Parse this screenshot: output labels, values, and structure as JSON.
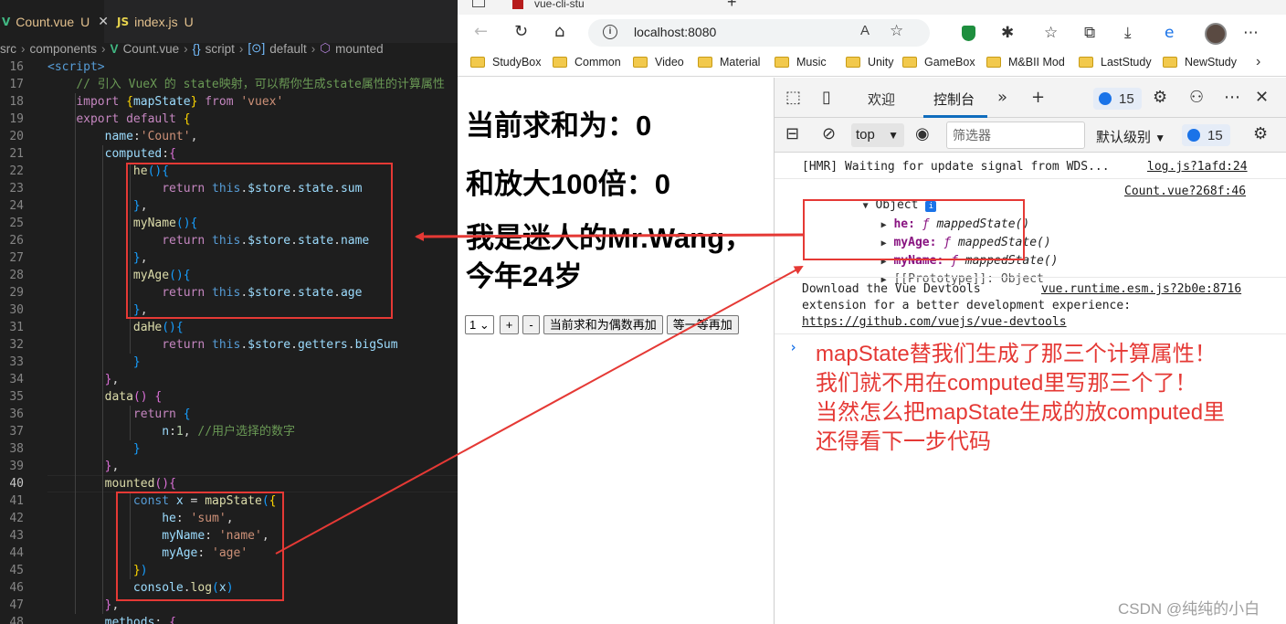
{
  "editor": {
    "tabs": [
      {
        "label": "Count.vue",
        "status": "U",
        "icon": "vue-icon"
      },
      {
        "label": "index.js",
        "status": "U",
        "icon": "js-icon"
      }
    ],
    "breadcrumb": [
      "src",
      "components",
      "Count.vue",
      "script",
      "default",
      "mounted"
    ],
    "lines": [
      {
        "n": "16",
        "html": "<span class=\"t\">&lt;script&gt;</span>"
      },
      {
        "n": "17",
        "html": "    <span class=\"c\">// 引入 VueX 的 state映射，可以帮你生成state属性的计算属性</span>"
      },
      {
        "n": "18",
        "html": "    <span class=\"k\">import</span> <span class=\"y\">{</span><span class=\"v\">mapState</span><span class=\"y\">}</span> <span class=\"k\">from</span> <span class=\"s\">'vuex'</span>"
      },
      {
        "n": "19",
        "html": "    <span class=\"k\">export default</span> <span class=\"y\">{</span>"
      },
      {
        "n": "20",
        "html": "        <span class=\"v\">name</span>:<span class=\"s\">'Count'</span>,"
      },
      {
        "n": "21",
        "html": "        <span class=\"v\">computed</span>:<span class=\"p\">{</span>"
      },
      {
        "n": "22",
        "html": "            <span class=\"f\">he</span><span class=\"bl\">(){</span>"
      },
      {
        "n": "23",
        "html": "                <span class=\"k\">return</span> <span class=\"b\">this</span>.<span class=\"v\">$store</span>.<span class=\"v\">state</span>.<span class=\"v\">sum</span>"
      },
      {
        "n": "24",
        "html": "            <span class=\"bl\">}</span>,"
      },
      {
        "n": "25",
        "html": "            <span class=\"f\">myName</span><span class=\"bl\">(){</span>"
      },
      {
        "n": "26",
        "html": "                <span class=\"k\">return</span> <span class=\"b\">this</span>.<span class=\"v\">$store</span>.<span class=\"v\">state</span>.<span class=\"v\">name</span>"
      },
      {
        "n": "27",
        "html": "            <span class=\"bl\">}</span>,"
      },
      {
        "n": "28",
        "html": "            <span class=\"f\">myAge</span><span class=\"bl\">(){</span>"
      },
      {
        "n": "29",
        "html": "                <span class=\"k\">return</span> <span class=\"b\">this</span>.<span class=\"v\">$store</span>.<span class=\"v\">state</span>.<span class=\"v\">age</span>"
      },
      {
        "n": "30",
        "html": "            <span class=\"bl\">}</span>,"
      },
      {
        "n": "31",
        "html": "            <span class=\"f\">daHe</span><span class=\"bl\">(){</span>"
      },
      {
        "n": "32",
        "html": "                <span class=\"k\">return</span> <span class=\"b\">this</span>.<span class=\"v\">$store</span>.<span class=\"v\">getters</span>.<span class=\"v\">bigSum</span>"
      },
      {
        "n": "33",
        "html": "            <span class=\"bl\">}</span>"
      },
      {
        "n": "34",
        "html": "        <span class=\"p\">}</span>,"
      },
      {
        "n": "35",
        "html": "        <span class=\"f\">data</span><span class=\"p\">()</span> <span class=\"p\">{</span>"
      },
      {
        "n": "36",
        "html": "            <span class=\"k\">return</span> <span class=\"bl\">{</span>"
      },
      {
        "n": "37",
        "html": "                <span class=\"v\">n</span>:<span class=\"n\">1</span>, <span class=\"c\">//用户选择的数字</span>"
      },
      {
        "n": "38",
        "html": "            <span class=\"bl\">}</span>"
      },
      {
        "n": "39",
        "html": "        <span class=\"p\">}</span>,"
      },
      {
        "n": "40",
        "html": "        <span class=\"f\">mounted</span><span class=\"p\">(){</span>"
      },
      {
        "n": "41",
        "html": "            <span class=\"b\">const</span> <span class=\"v\">x</span> = <span class=\"f\">mapState</span><span class=\"bl\">(</span><span class=\"y\">{</span>"
      },
      {
        "n": "42",
        "html": "                <span class=\"v\">he</span>: <span class=\"s\">'sum'</span>,"
      },
      {
        "n": "43",
        "html": "                <span class=\"v\">myName</span>: <span class=\"s\">'name'</span>,"
      },
      {
        "n": "44",
        "html": "                <span class=\"v\">myAge</span>: <span class=\"s\">'age'</span>"
      },
      {
        "n": "45",
        "html": "            <span class=\"y\">}</span><span class=\"bl\">)</span>"
      },
      {
        "n": "46",
        "html": "            <span class=\"v\">console</span>.<span class=\"f\">log</span><span class=\"bl\">(</span><span class=\"v\">x</span><span class=\"bl\">)</span>"
      },
      {
        "n": "47",
        "html": "        <span class=\"p\">}</span>,"
      },
      {
        "n": "48",
        "html": "        <span class=\"v\">methods</span>: <span class=\"p\">{</span>"
      }
    ],
    "current_line": "40"
  },
  "browser": {
    "tab_title": "vue-cli-stu",
    "url": "localhost:8080",
    "bookmarks": [
      "StudyBox",
      "Common",
      "Video",
      "Material",
      "Music",
      "Unity",
      "GameBox",
      "M&BII Mod",
      "LastStudy",
      "NewStudy"
    ],
    "page": {
      "sum_text": "当前求和为：0",
      "big_text": "和放大100倍：0",
      "me_text": "我是迷人的Mr.Wang，今年24岁",
      "select_value": "1",
      "plus_label": "+",
      "minus_label": "-",
      "odd_add_label": "当前求和为偶数再加",
      "wait_add_label": "等一等再加"
    }
  },
  "devtools": {
    "tabs": [
      "欢迎",
      "控制台"
    ],
    "active_tab": "控制台",
    "issue_count": "15",
    "context": "top",
    "filter_placeholder": "筛选器",
    "levels_label": "默认级别",
    "messages": {
      "hmr": "[HMR] Waiting for update signal from WDS...",
      "hmr_src": "log.js?1afd:24",
      "object_label": "Object",
      "object_src": "Count.vue?268f:46",
      "props": [
        {
          "key": "he",
          "value": "mappedState()"
        },
        {
          "key": "myAge",
          "value": "mappedState()"
        },
        {
          "key": "myName",
          "value": "mappedState()"
        }
      ],
      "fn_symbol": "ƒ",
      "prototype": "[[Prototype]]: Object",
      "devtools_line1": "Download the Vue Devtools",
      "devtools_line2": "extension for a better development experience:",
      "devtools_link": "https://github.com/vuejs/vue-devtools",
      "devtools_src": "vue.runtime.esm.js?2b0e:8716"
    }
  },
  "annotation": {
    "lines": [
      "mapState替我们生成了那三个计算属性！",
      "我们就不用在computed里写那三个了！",
      "当然怎么把mapState生成的放computed里",
      "还得看下一步代码"
    ],
    "color": "#e53935"
  },
  "watermark": "CSDN @纯纯的小白"
}
